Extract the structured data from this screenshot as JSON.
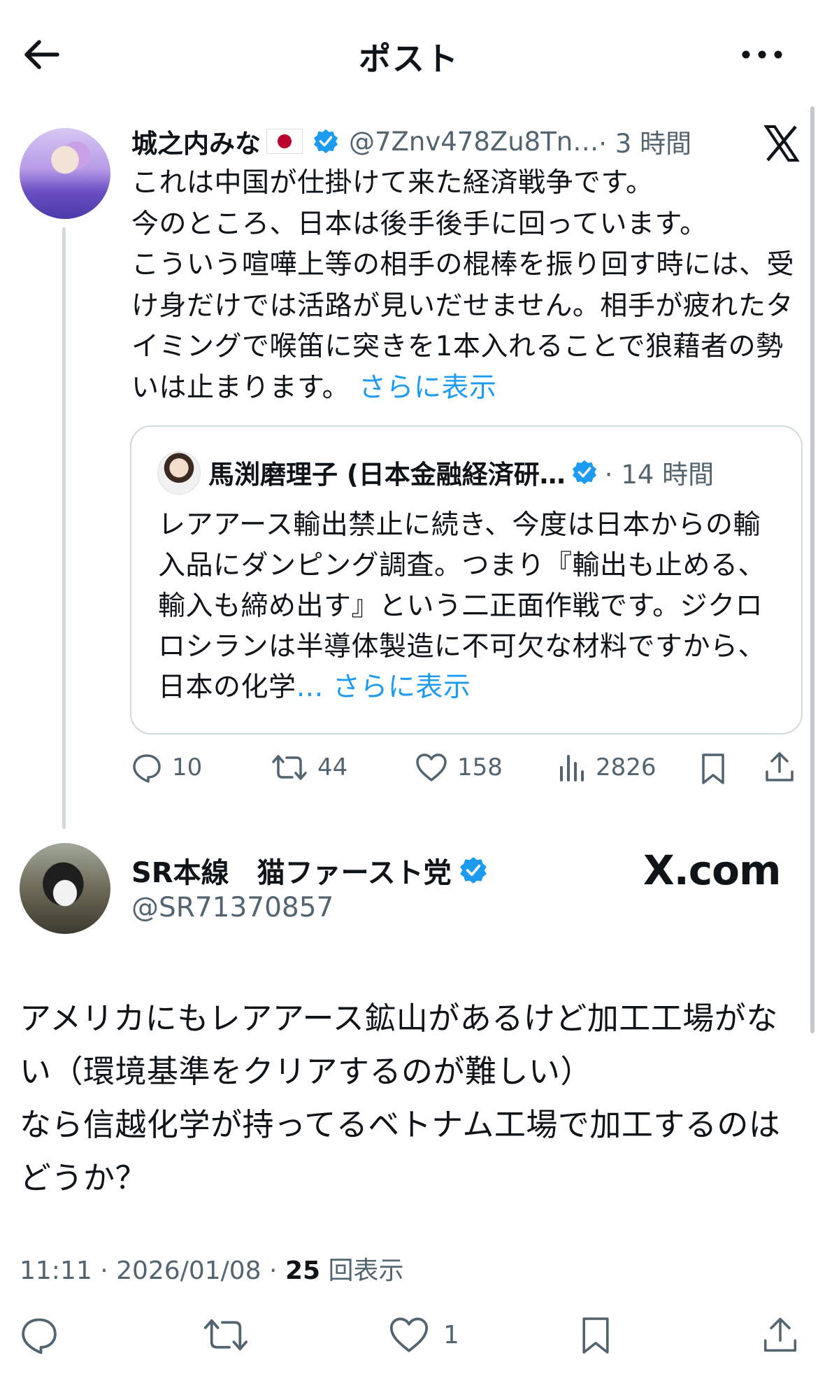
{
  "header": {
    "title": "ポスト"
  },
  "tweet1": {
    "name": "城之内みな",
    "handle": "@7Znv478Zu8Tn…",
    "time": "· 3 時間",
    "body": "これは中国が仕掛けて来た経済戦争です。\n今のところ、日本は後手後手に回っています。\nこういう喧嘩上等の相手の棍棒を振り回す時には、受け身だけでは活路が見いだせません。相手が疲れたタイミングで喉笛に突きを1本入れることで狼藉者の勢いは止まります。",
    "show_more": "さらに表示",
    "quote": {
      "name": "馬渕磨理子 (日本金融経済研…",
      "time": "· 14 時間",
      "body": "レアアース輸出禁止に続き、今度は日本からの輸入品にダンピング調査。つまり『輸出も止める、輸入も締め出す』という二正面作戦です。ジクロロシランは半導体製造に不可欠な材料ですから、日本の化学",
      "ellipsis": "…",
      "show_more": "さらに表示"
    },
    "actions": {
      "replies": "10",
      "retweets": "44",
      "likes": "158",
      "views": "2826"
    }
  },
  "tweet2": {
    "name": "SR本線　猫ファースト党",
    "handle": "@SR71370857",
    "watermark": "X.com",
    "body": "アメリカにもレアアース鉱山があるけど加工工場がない（環境基準をクリアするのが難しい）\nなら信越化学が持ってるベトナム工場で加工するのはどうか？",
    "time": "11:11",
    "date": "2026/01/08",
    "views_count": "25",
    "views_label": "回表示",
    "likes": "1"
  },
  "colors": {
    "accent": "#1d9bf0",
    "secondary_text": "#536471",
    "text": "#0f1419"
  },
  "icons": [
    "back-arrow-icon",
    "more-icon",
    "x-logo-icon",
    "verified-badge-icon",
    "reply-icon",
    "retweet-icon",
    "like-icon",
    "views-icon",
    "bookmark-icon",
    "share-icon"
  ]
}
